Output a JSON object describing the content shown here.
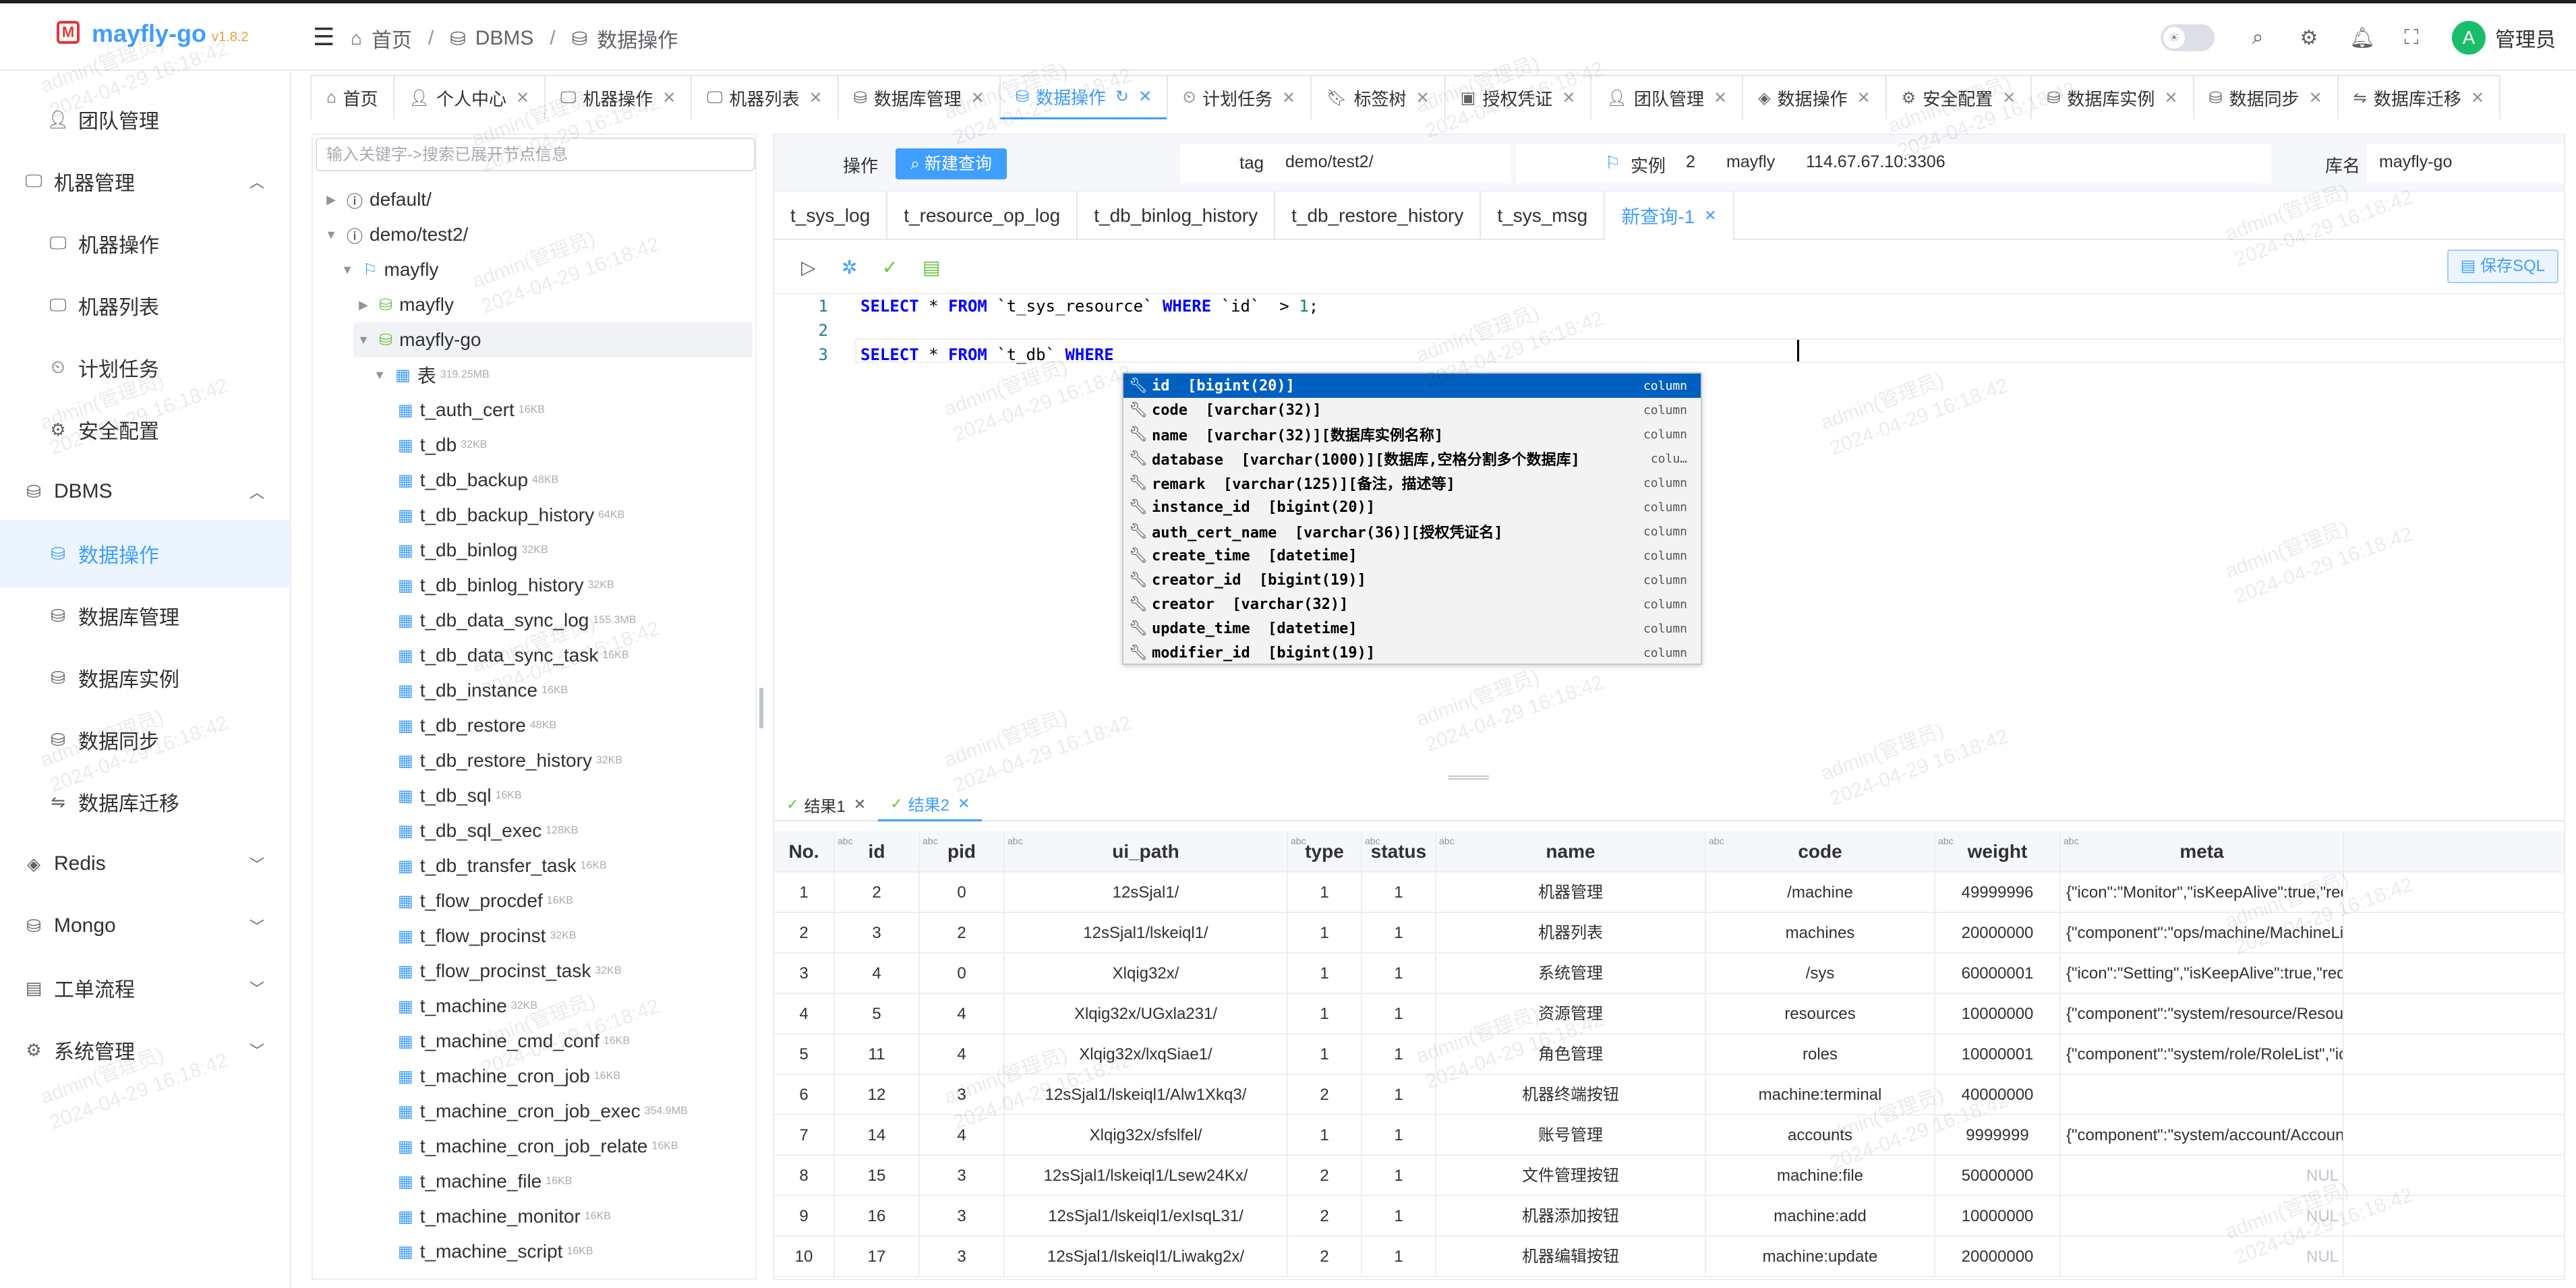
{
  "app": {
    "name": "mayfly-go",
    "version": "v1.8.2"
  },
  "breadcrumb": [
    "首页",
    "DBMS",
    "数据操作"
  ],
  "user": {
    "avatar_letter": "A",
    "name": "管理员"
  },
  "sidebar": [
    {
      "label": "团队管理",
      "type": "sub",
      "icon": "user"
    },
    {
      "label": "机器管理",
      "type": "group",
      "icon": "monitor",
      "open": true
    },
    {
      "label": "机器操作",
      "type": "sub",
      "icon": "monitor"
    },
    {
      "label": "机器列表",
      "type": "sub",
      "icon": "monitor"
    },
    {
      "label": "计划任务",
      "type": "sub",
      "icon": "clock"
    },
    {
      "label": "安全配置",
      "type": "sub",
      "icon": "gear"
    },
    {
      "label": "DBMS",
      "type": "group",
      "icon": "database",
      "open": true
    },
    {
      "label": "数据操作",
      "type": "sub",
      "icon": "database",
      "active": true
    },
    {
      "label": "数据库管理",
      "type": "sub",
      "icon": "database"
    },
    {
      "label": "数据库实例",
      "type": "sub",
      "icon": "database"
    },
    {
      "label": "数据同步",
      "type": "sub",
      "icon": "database"
    },
    {
      "label": "数据库迁移",
      "type": "sub",
      "icon": "migrate"
    },
    {
      "label": "Redis",
      "type": "group",
      "icon": "redis",
      "open": false
    },
    {
      "label": "Mongo",
      "type": "group",
      "icon": "database",
      "open": false
    },
    {
      "label": "工单流程",
      "type": "group",
      "icon": "flow",
      "open": false
    },
    {
      "label": "系统管理",
      "type": "group",
      "icon": "gear",
      "open": false
    }
  ],
  "tabs": [
    {
      "label": "首页",
      "icon": "home",
      "closable": false
    },
    {
      "label": "个人中心",
      "icon": "user",
      "closable": true
    },
    {
      "label": "机器操作",
      "icon": "monitor",
      "closable": true
    },
    {
      "label": "机器列表",
      "icon": "monitor",
      "closable": true
    },
    {
      "label": "数据库管理",
      "icon": "database",
      "closable": true
    },
    {
      "label": "数据操作",
      "icon": "database",
      "closable": true,
      "active": true
    },
    {
      "label": "计划任务",
      "icon": "clock",
      "closable": true
    },
    {
      "label": "标签树",
      "icon": "tag",
      "closable": true
    },
    {
      "label": "授权凭证",
      "icon": "cert",
      "closable": true
    },
    {
      "label": "团队管理",
      "icon": "user",
      "closable": true
    },
    {
      "label": "数据操作",
      "icon": "layers",
      "closable": true
    },
    {
      "label": "安全配置",
      "icon": "gear",
      "closable": true
    },
    {
      "label": "数据库实例",
      "icon": "database",
      "closable": true
    },
    {
      "label": "数据同步",
      "icon": "database",
      "closable": true
    },
    {
      "label": "数据库迁移",
      "icon": "migrate",
      "closable": true
    }
  ],
  "tree": {
    "search_placeholder": "输入关键字->搜索已展开节点信息",
    "nodes": [
      {
        "label": "default/",
        "level": 0,
        "kind": "info",
        "caret": "right"
      },
      {
        "label": "demo/test2/",
        "level": 0,
        "kind": "info",
        "caret": "down"
      },
      {
        "label": "mayfly",
        "level": 1,
        "kind": "mysql",
        "caret": "down"
      },
      {
        "label": "mayfly",
        "level": 2,
        "kind": "db",
        "caret": "right"
      },
      {
        "label": "mayfly-go",
        "level": 2,
        "kind": "db",
        "caret": "down",
        "selected": true
      },
      {
        "label": "表",
        "level": 3,
        "kind": "tables",
        "caret": "down",
        "size": "319.25MB"
      },
      {
        "label": "t_auth_cert",
        "level": 4,
        "kind": "table",
        "size": "16KB"
      },
      {
        "label": "t_db",
        "level": 4,
        "kind": "table",
        "size": "32KB"
      },
      {
        "label": "t_db_backup",
        "level": 4,
        "kind": "table",
        "size": "48KB"
      },
      {
        "label": "t_db_backup_history",
        "level": 4,
        "kind": "table",
        "size": "64KB"
      },
      {
        "label": "t_db_binlog",
        "level": 4,
        "kind": "table",
        "size": "32KB"
      },
      {
        "label": "t_db_binlog_history",
        "level": 4,
        "kind": "table",
        "size": "32KB"
      },
      {
        "label": "t_db_data_sync_log",
        "level": 4,
        "kind": "table",
        "size": "155.3MB"
      },
      {
        "label": "t_db_data_sync_task",
        "level": 4,
        "kind": "table",
        "size": "16KB"
      },
      {
        "label": "t_db_instance",
        "level": 4,
        "kind": "table",
        "size": "16KB"
      },
      {
        "label": "t_db_restore",
        "level": 4,
        "kind": "table",
        "size": "48KB"
      },
      {
        "label": "t_db_restore_history",
        "level": 4,
        "kind": "table",
        "size": "32KB"
      },
      {
        "label": "t_db_sql",
        "level": 4,
        "kind": "table",
        "size": "16KB"
      },
      {
        "label": "t_db_sql_exec",
        "level": 4,
        "kind": "table",
        "size": "128KB"
      },
      {
        "label": "t_db_transfer_task",
        "level": 4,
        "kind": "table",
        "size": "16KB"
      },
      {
        "label": "t_flow_procdef",
        "level": 4,
        "kind": "table",
        "size": "16KB"
      },
      {
        "label": "t_flow_procinst",
        "level": 4,
        "kind": "table",
        "size": "32KB"
      },
      {
        "label": "t_flow_procinst_task",
        "level": 4,
        "kind": "table",
        "size": "32KB"
      },
      {
        "label": "t_machine",
        "level": 4,
        "kind": "table",
        "size": "32KB"
      },
      {
        "label": "t_machine_cmd_conf",
        "level": 4,
        "kind": "table",
        "size": "16KB"
      },
      {
        "label": "t_machine_cron_job",
        "level": 4,
        "kind": "table",
        "size": "16KB"
      },
      {
        "label": "t_machine_cron_job_exec",
        "level": 4,
        "kind": "table",
        "size": "354.9MB"
      },
      {
        "label": "t_machine_cron_job_relate",
        "level": 4,
        "kind": "table",
        "size": "16KB"
      },
      {
        "label": "t_machine_file",
        "level": 4,
        "kind": "table",
        "size": "16KB"
      },
      {
        "label": "t_machine_monitor",
        "level": 4,
        "kind": "table",
        "size": "16KB"
      },
      {
        "label": "t_machine_script",
        "level": 4,
        "kind": "table",
        "size": "16KB"
      }
    ]
  },
  "toolbar": {
    "op_label": "操作",
    "new_query": "新建查询",
    "tag_label": "tag",
    "tag_value": "demo/test2/",
    "instance_label": "实例",
    "instance_id": "2",
    "instance_name": "mayfly",
    "instance_addr": "114.67.67.10:3306",
    "db_label": "库名",
    "db_value": "mayfly-go"
  },
  "db_tabs": [
    {
      "label": "t_sys_log"
    },
    {
      "label": "t_resource_op_log"
    },
    {
      "label": "t_db_binlog_history"
    },
    {
      "label": "t_db_restore_history"
    },
    {
      "label": "t_sys_msg"
    },
    {
      "label": "新查询-1",
      "active": true,
      "closable": true
    }
  ],
  "editor": {
    "save_sql": "保存SQL",
    "lines": [
      {
        "no": "1",
        "tokens": [
          {
            "t": "SELECT",
            "c": "kw"
          },
          {
            "t": " * ",
            "c": ""
          },
          {
            "t": "FROM",
            "c": "kw"
          },
          {
            "t": " `t_sys_resource` ",
            "c": ""
          },
          {
            "t": "WHERE",
            "c": "kw"
          },
          {
            "t": " `id`  > ",
            "c": ""
          },
          {
            "t": "1",
            "c": "num"
          },
          {
            "t": ";",
            "c": ""
          }
        ]
      },
      {
        "no": "2",
        "tokens": []
      },
      {
        "no": "3",
        "tokens": [
          {
            "t": "SELECT",
            "c": "kw"
          },
          {
            "t": " * ",
            "c": ""
          },
          {
            "t": "FROM",
            "c": "kw"
          },
          {
            "t": " `t_db` ",
            "c": ""
          },
          {
            "t": "WHERE",
            "c": "kw"
          },
          {
            "t": " ",
            "c": ""
          }
        ]
      }
    ],
    "suggestions": [
      {
        "text": "id  [bigint(20)]",
        "kind": "column",
        "selected": true
      },
      {
        "text": "code  [varchar(32)]",
        "kind": "column"
      },
      {
        "text": "name  [varchar(32)][数据库实例名称]",
        "kind": "column"
      },
      {
        "text": "database  [varchar(1000)][数据库,空格分割多个数据库]",
        "kind": "colu…"
      },
      {
        "text": "remark  [varchar(125)][备注，描述等]",
        "kind": "column"
      },
      {
        "text": "instance_id  [bigint(20)]",
        "kind": "column"
      },
      {
        "text": "auth_cert_name  [varchar(36)][授权凭证名]",
        "kind": "column"
      },
      {
        "text": "create_time  [datetime]",
        "kind": "column"
      },
      {
        "text": "creator_id  [bigint(19)]",
        "kind": "column"
      },
      {
        "text": "creator  [varchar(32)]",
        "kind": "column"
      },
      {
        "text": "update_time  [datetime]",
        "kind": "column"
      },
      {
        "text": "modifier_id  [bigint(19)]",
        "kind": "column"
      }
    ]
  },
  "results": {
    "tabs": [
      {
        "label": "结果1"
      },
      {
        "label": "结果2",
        "active": true
      }
    ],
    "abc": "abc",
    "columns": [
      "No.",
      "id",
      "pid",
      "ui_path",
      "type",
      "status",
      "name",
      "code",
      "weight",
      "meta"
    ],
    "rows": [
      [
        "1",
        "2",
        "0",
        "12sSjal1/",
        "1",
        "1",
        "机器管理",
        "/machine",
        "49999996",
        "{\"icon\":\"Monitor\",\"isKeepAlive\":true,\"redirec"
      ],
      [
        "2",
        "3",
        "2",
        "12sSjal1/lskeiql1/",
        "1",
        "1",
        "机器列表",
        "machines",
        "20000000",
        "{\"component\":\"ops/machine/MachineList\",\"ic"
      ],
      [
        "3",
        "4",
        "0",
        "Xlqig32x/",
        "1",
        "1",
        "系统管理",
        "/sys",
        "60000001",
        "{\"icon\":\"Setting\",\"isKeepAlive\":true,\"redire"
      ],
      [
        "4",
        "5",
        "4",
        "Xlqig32x/UGxla231/",
        "1",
        "1",
        "资源管理",
        "resources",
        "10000000",
        "{\"component\":\"system/resource/ResourceList"
      ],
      [
        "5",
        "11",
        "4",
        "Xlqig32x/lxqSiae1/",
        "1",
        "1",
        "角色管理",
        "roles",
        "10000001",
        "{\"component\":\"system/role/RoleList\",\"icon\":\"I"
      ],
      [
        "6",
        "12",
        "3",
        "12sSjal1/lskeiql1/Alw1Xkq3/",
        "2",
        "1",
        "机器终端按钮",
        "machine:terminal",
        "40000000",
        ""
      ],
      [
        "7",
        "14",
        "4",
        "Xlqig32x/sfslfel/",
        "1",
        "1",
        "账号管理",
        "accounts",
        "9999999",
        "{\"component\":\"system/account/AccountList\","
      ],
      [
        "8",
        "15",
        "3",
        "12sSjal1/lskeiql1/Lsew24Kx/",
        "2",
        "1",
        "文件管理按钮",
        "machine:file",
        "50000000",
        "NUL"
      ],
      [
        "9",
        "16",
        "3",
        "12sSjal1/lskeiql1/exIsqL31/",
        "2",
        "1",
        "机器添加按钮",
        "machine:add",
        "10000000",
        "NUL"
      ],
      [
        "10",
        "17",
        "3",
        "12sSjal1/lskeiql1/Liwakg2x/",
        "2",
        "1",
        "机器编辑按钮",
        "machine:update",
        "20000000",
        "NUL"
      ]
    ]
  },
  "watermark": "admin(管理员)\n2024-04-29 16:18:42",
  "colors": {
    "accent": "#409eff",
    "active_bg": "#ecf5ff",
    "success": "#67c23a",
    "logo_red": "#e6353a",
    "version": "#e6a23c"
  }
}
